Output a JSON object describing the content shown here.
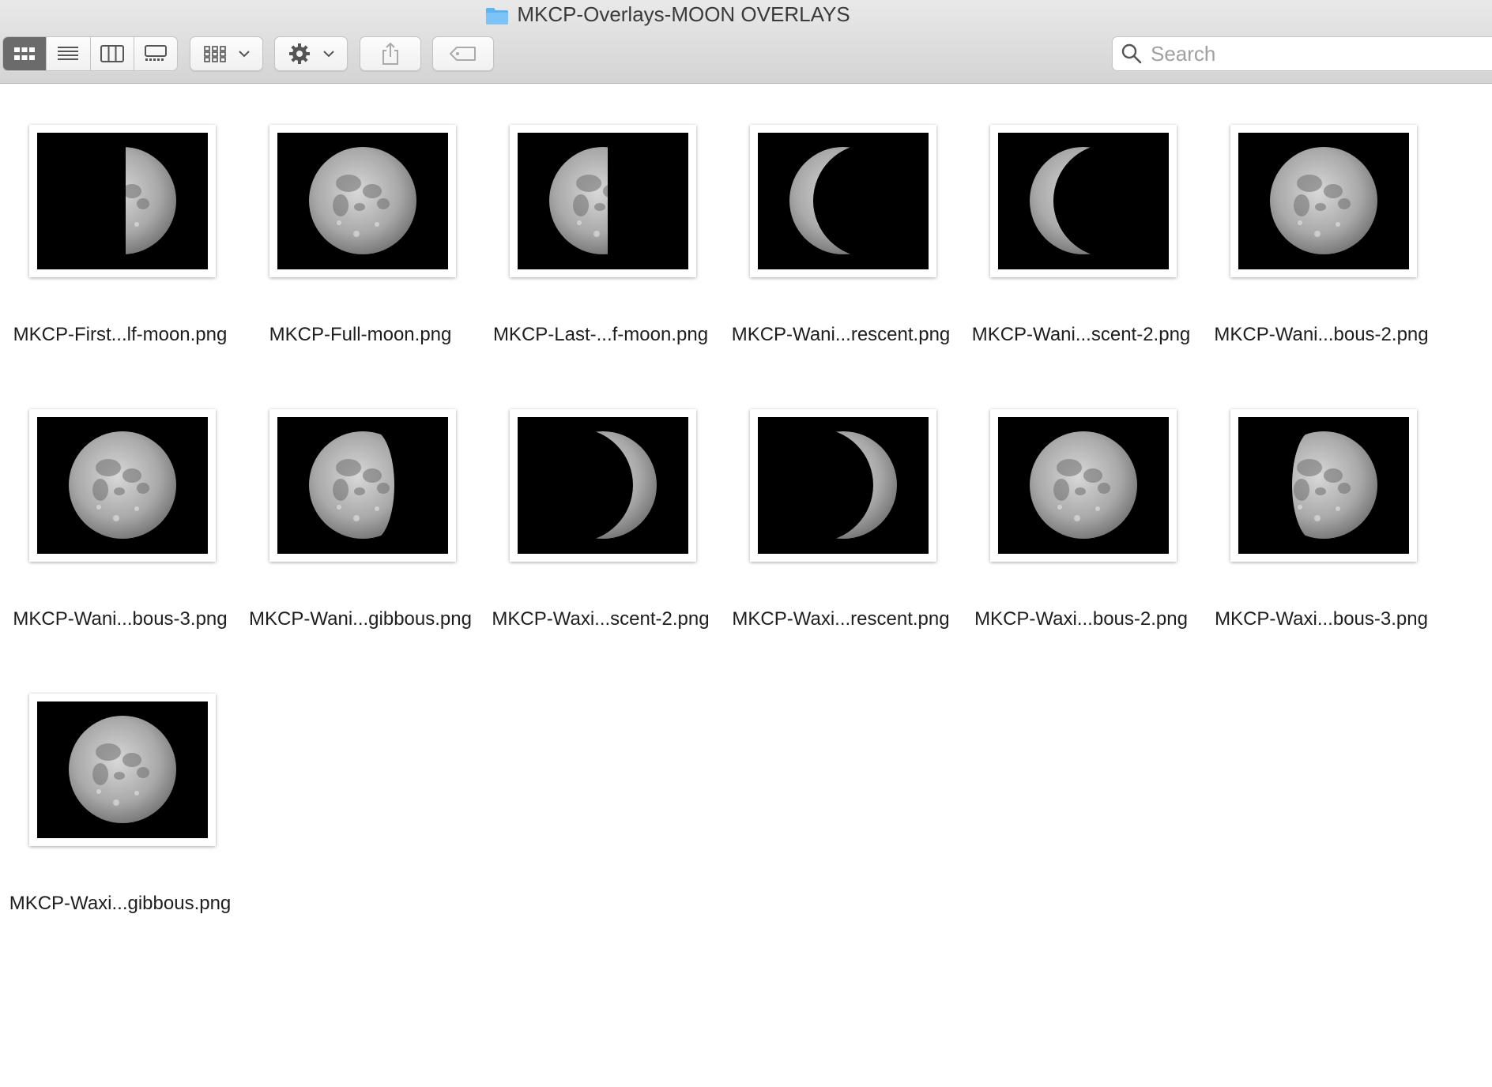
{
  "window": {
    "title": "MKCP-Overlays-MOON OVERLAYS",
    "folder_icon": "folder-icon",
    "accent_color": "#6b6b6b"
  },
  "toolbar": {
    "view_modes": [
      "icon-view-icon",
      "list-view-icon",
      "column-view-icon",
      "gallery-view-icon"
    ],
    "active_view": "icon-view-icon",
    "group_icon": "group-grid-icon",
    "action_icon": "gear-icon",
    "share_icon": "share-icon",
    "tag_icon": "tag-icon"
  },
  "search": {
    "placeholder": "Search",
    "icon": "search-icon"
  },
  "files": [
    {
      "name": "MKCP-First...lf-moon.png",
      "phase": "first-quarter"
    },
    {
      "name": "MKCP-Full-moon.png",
      "phase": "full"
    },
    {
      "name": "MKCP-Last-...f-moon.png",
      "phase": "last-quarter"
    },
    {
      "name": "MKCP-Wani...rescent.png",
      "phase": "waning-crescent"
    },
    {
      "name": "MKCP-Wani...scent-2.png",
      "phase": "waning-crescent"
    },
    {
      "name": "MKCP-Wani...bous-2.png",
      "phase": "full"
    },
    {
      "name": "MKCP-Wani...bous-3.png",
      "phase": "full"
    },
    {
      "name": "MKCP-Wani...gibbous.png",
      "phase": "waning-gibbous"
    },
    {
      "name": "MKCP-Waxi...scent-2.png",
      "phase": "waxing-crescent"
    },
    {
      "name": "MKCP-Waxi...rescent.png",
      "phase": "waxing-crescent"
    },
    {
      "name": "MKCP-Waxi...bous-2.png",
      "phase": "full"
    },
    {
      "name": "MKCP-Waxi...bous-3.png",
      "phase": "waxing-gibbous"
    },
    {
      "name": "MKCP-Waxi...gibbous.png",
      "phase": "full"
    }
  ]
}
